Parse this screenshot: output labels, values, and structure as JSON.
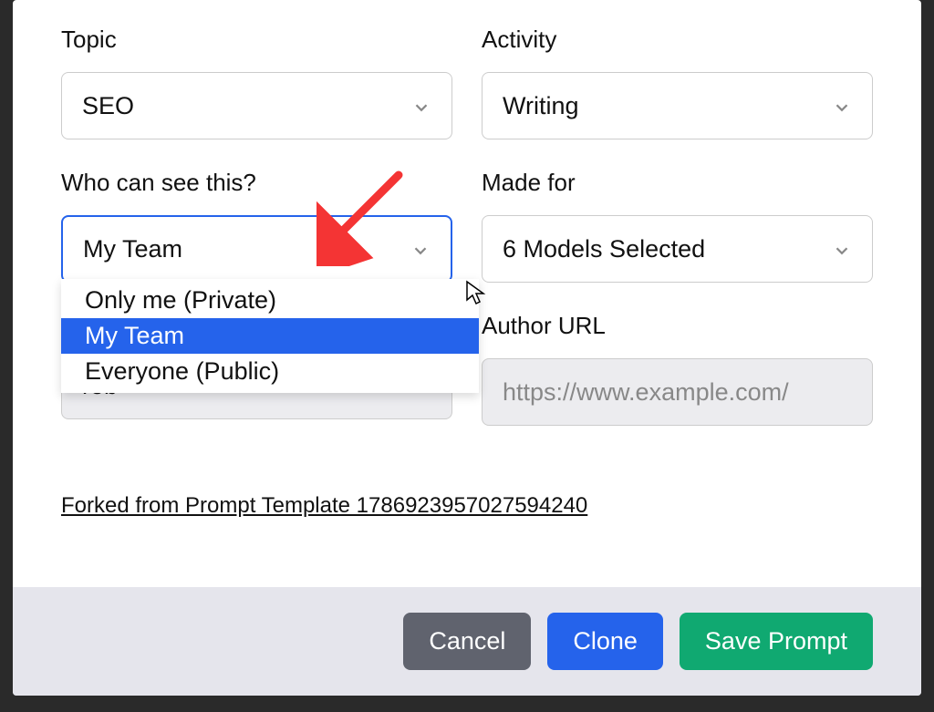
{
  "form": {
    "topic": {
      "label": "Topic",
      "value": "SEO"
    },
    "activity": {
      "label": "Activity",
      "value": "Writing"
    },
    "visibility": {
      "label": "Who can see this?",
      "value": "My Team",
      "options": [
        "Only me (Private)",
        "My Team",
        "Everyone (Public)"
      ]
    },
    "made_for": {
      "label": "Made for",
      "value": "6 Models Selected"
    },
    "author_url": {
      "label": "Author URL",
      "placeholder": "https://www.example.com/",
      "value": ""
    },
    "author_name": {
      "value": "rob"
    }
  },
  "forked_link": "Forked from Prompt Template 1786923957027594240",
  "footer": {
    "cancel": "Cancel",
    "clone": "Clone",
    "save": "Save Prompt"
  },
  "colors": {
    "accent_blue": "#2563eb",
    "accent_green": "#10a971",
    "arrow_red": "#f43434"
  }
}
